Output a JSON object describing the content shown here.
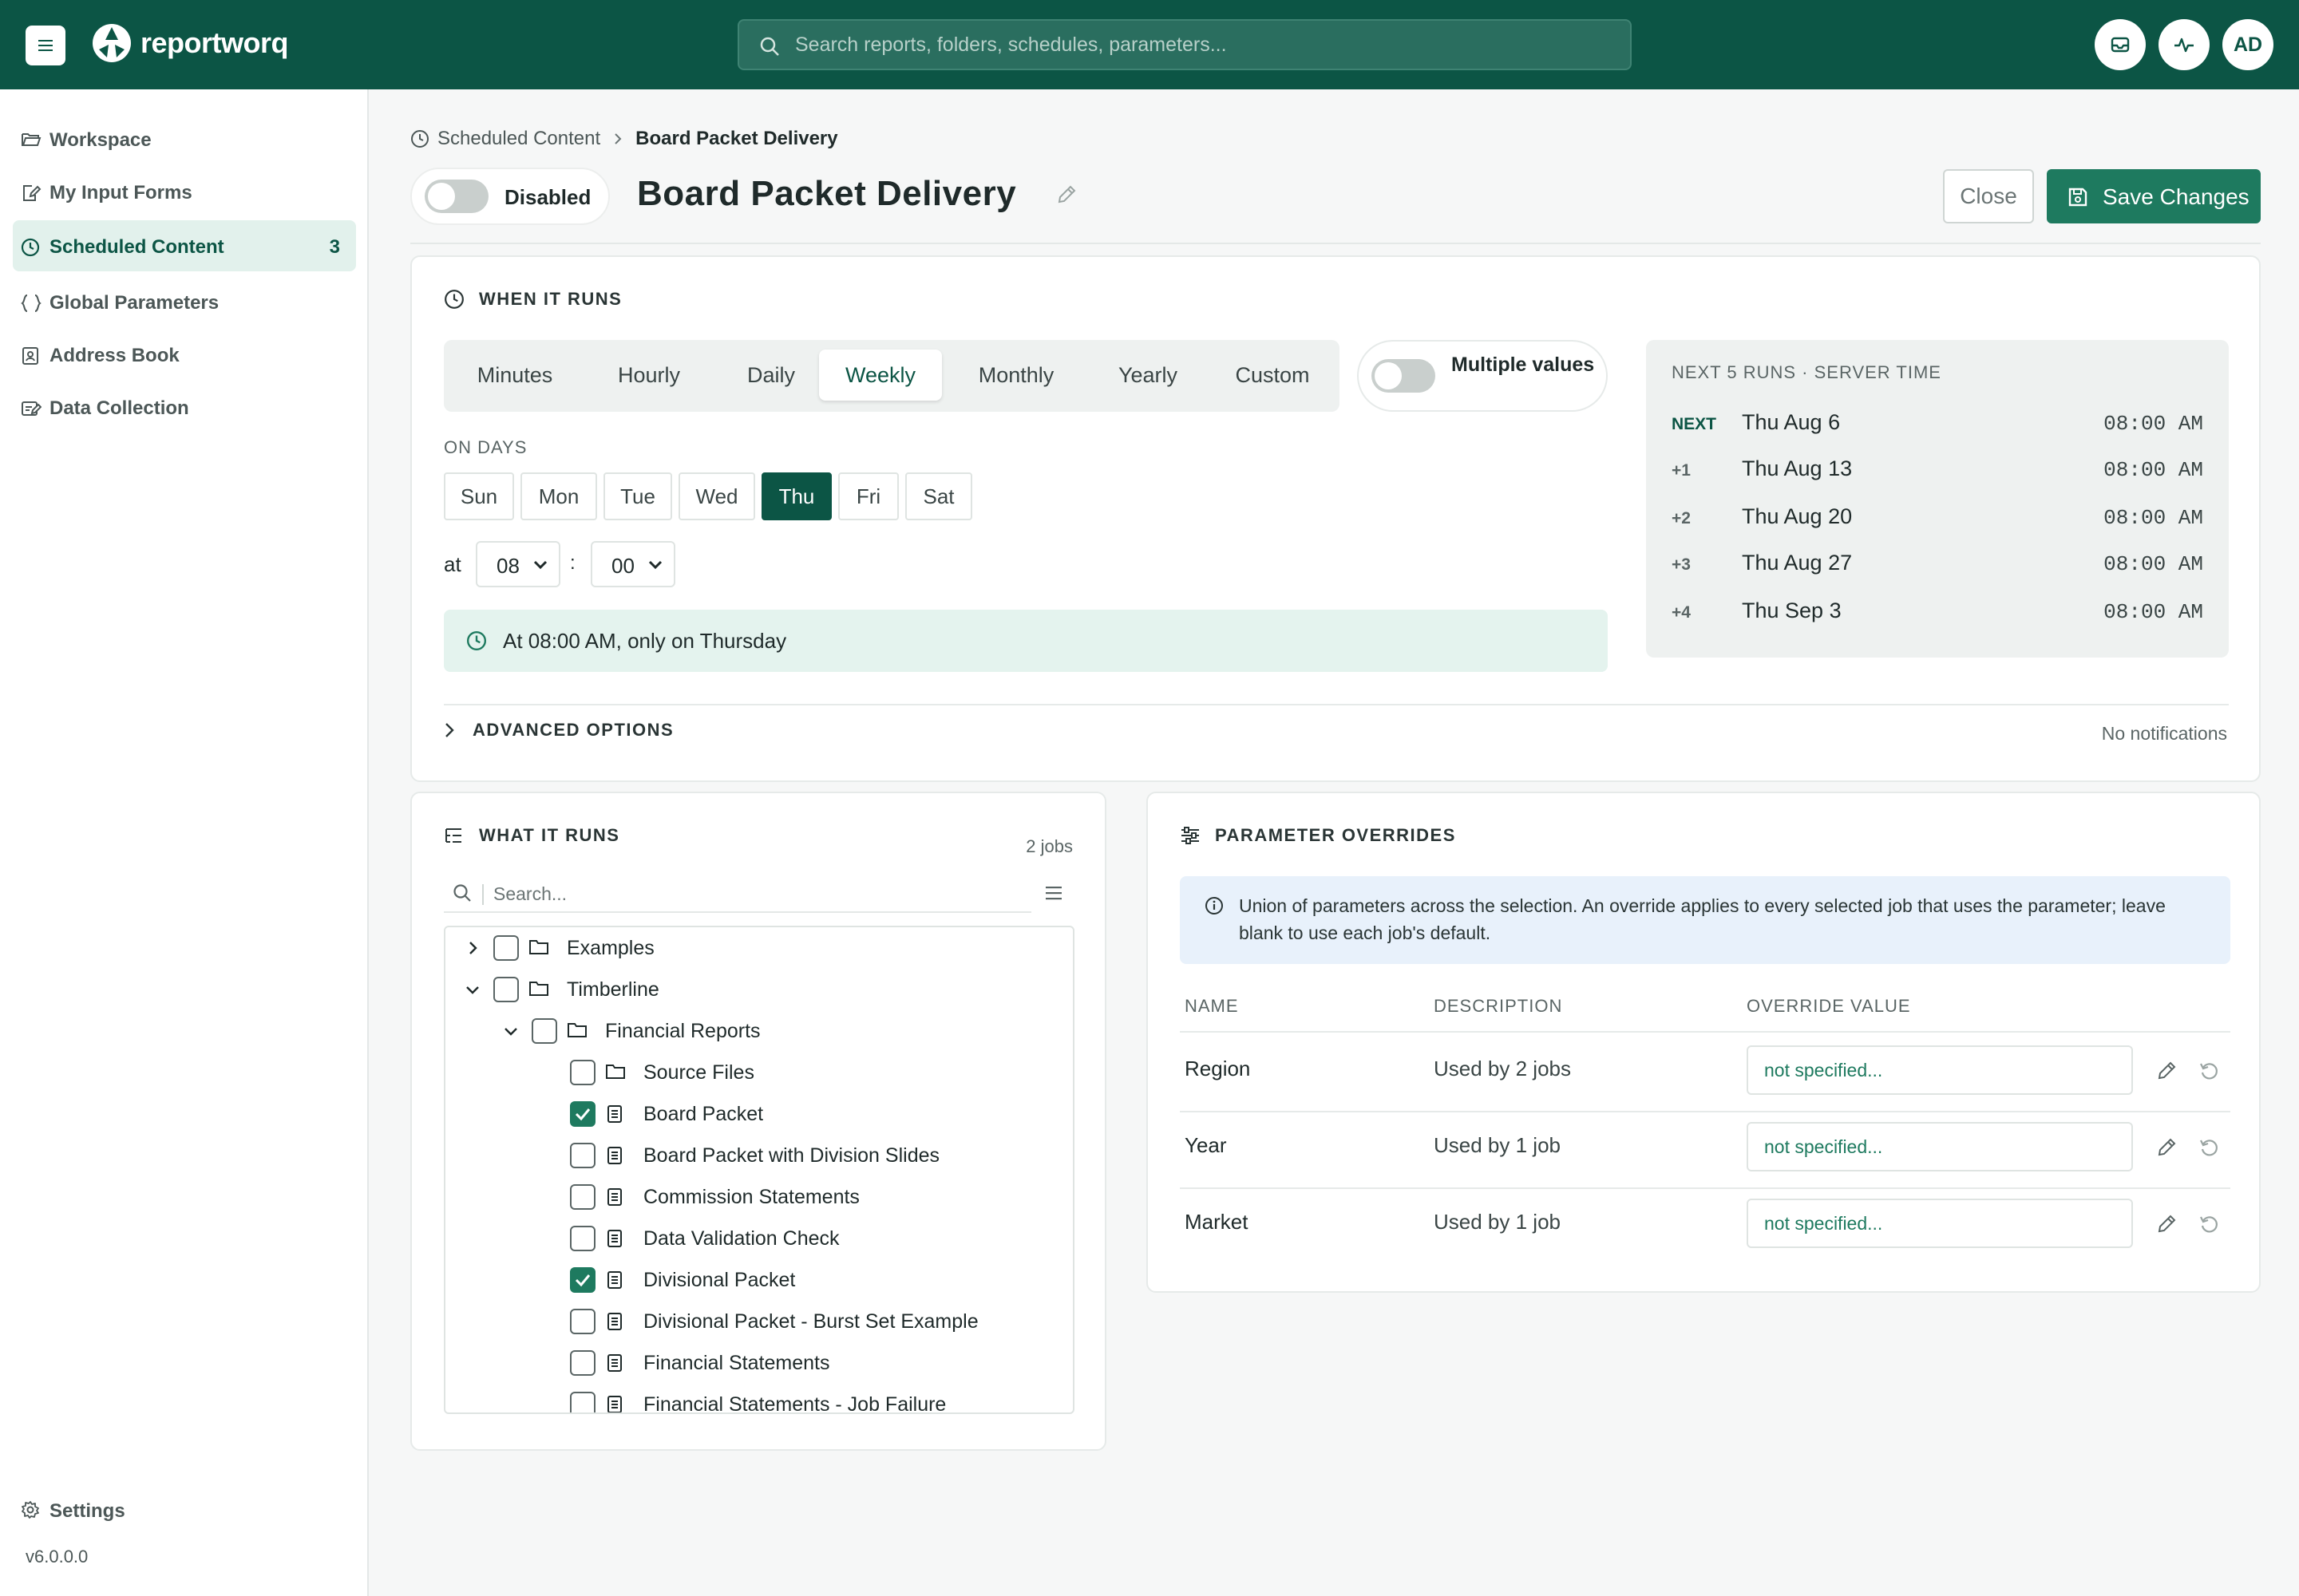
{
  "app": {
    "logo_text": "reportworq",
    "search_placeholder": "Search reports, folders, schedules, parameters...",
    "avatar_initials": "AD",
    "accent_color": "#0c5545"
  },
  "sidebar": {
    "items": [
      {
        "label": "Workspace",
        "icon": "folder-open-icon"
      },
      {
        "label": "My Input Forms",
        "icon": "form-edit-icon"
      },
      {
        "label": "Scheduled Content",
        "icon": "clock-icon",
        "badge": "3",
        "active": true
      },
      {
        "label": "Global Parameters",
        "icon": "braces-icon"
      },
      {
        "label": "Address Book",
        "icon": "address-book-icon"
      },
      {
        "label": "Data Collection",
        "icon": "data-collection-icon"
      }
    ],
    "settings_label": "Settings",
    "version": "v6.0.0.0"
  },
  "header": {
    "breadcrumb_parent": "Scheduled Content",
    "breadcrumb_current": "Board Packet Delivery",
    "status_label": "Disabled",
    "title": "Board Packet Delivery",
    "close_label": "Close",
    "save_label": "Save Changes"
  },
  "when": {
    "title": "WHEN IT RUNS",
    "frequencies": [
      "Minutes",
      "Hourly",
      "Daily",
      "Weekly",
      "Monthly",
      "Yearly",
      "Custom"
    ],
    "active_frequency": "Weekly",
    "multiple_values_label": "Multiple values",
    "on_days_label": "ON DAYS",
    "days": [
      "Sun",
      "Mon",
      "Tue",
      "Wed",
      "Thu",
      "Fri",
      "Sat"
    ],
    "active_day": "Thu",
    "at_label": "at",
    "hour": "08",
    "minute": "00",
    "summary": "At 08:00 AM, only on Thursday",
    "next_runs_title": "NEXT 5 RUNS · SERVER TIME",
    "next_runs": [
      {
        "idx": "NEXT",
        "date": "Thu Aug 6",
        "time": "08:00 AM"
      },
      {
        "idx": "+1",
        "date": "Thu Aug 13",
        "time": "08:00 AM"
      },
      {
        "idx": "+2",
        "date": "Thu Aug 20",
        "time": "08:00 AM"
      },
      {
        "idx": "+3",
        "date": "Thu Aug 27",
        "time": "08:00 AM"
      },
      {
        "idx": "+4",
        "date": "Thu Sep 3",
        "time": "08:00 AM"
      }
    ],
    "advanced_label": "ADVANCED OPTIONS",
    "notifications_label": "No notifications"
  },
  "what": {
    "title": "WHAT IT RUNS",
    "count": "2 jobs",
    "search_placeholder": "Search...",
    "tree": [
      {
        "label": "Examples",
        "type": "folder",
        "level": 0,
        "expanded": false,
        "checked": false
      },
      {
        "label": "Timberline",
        "type": "folder",
        "level": 0,
        "expanded": true,
        "checked": false
      },
      {
        "label": "Financial Reports",
        "type": "folder",
        "level": 1,
        "expanded": true,
        "checked": false
      },
      {
        "label": "Source Files",
        "type": "folder",
        "level": 2,
        "checked": false
      },
      {
        "label": "Board Packet",
        "type": "report",
        "level": 2,
        "checked": true
      },
      {
        "label": "Board Packet with Division Slides",
        "type": "report",
        "level": 2,
        "checked": false
      },
      {
        "label": "Commission Statements",
        "type": "report",
        "level": 2,
        "checked": false
      },
      {
        "label": "Data Validation Check",
        "type": "report",
        "level": 2,
        "checked": false
      },
      {
        "label": "Divisional Packet",
        "type": "report",
        "level": 2,
        "checked": true
      },
      {
        "label": "Divisional Packet - Burst Set Example",
        "type": "report",
        "level": 2,
        "checked": false
      },
      {
        "label": "Financial Statements",
        "type": "report",
        "level": 2,
        "checked": false
      },
      {
        "label": "Financial Statements - Job Failure",
        "type": "report",
        "level": 2,
        "checked": false
      }
    ]
  },
  "params": {
    "title": "PARAMETER OVERRIDES",
    "info": "Union of parameters across the selection. An override applies to every selected job that uses the parameter; leave blank to use each job's default.",
    "headers": [
      "NAME",
      "DESCRIPTION",
      "OVERRIDE VALUE"
    ],
    "rows": [
      {
        "name": "Region",
        "description": "Used by 2 jobs",
        "placeholder": "not specified..."
      },
      {
        "name": "Year",
        "description": "Used by 1 job",
        "placeholder": "not specified..."
      },
      {
        "name": "Market",
        "description": "Used by 1 job",
        "placeholder": "not specified..."
      }
    ]
  }
}
